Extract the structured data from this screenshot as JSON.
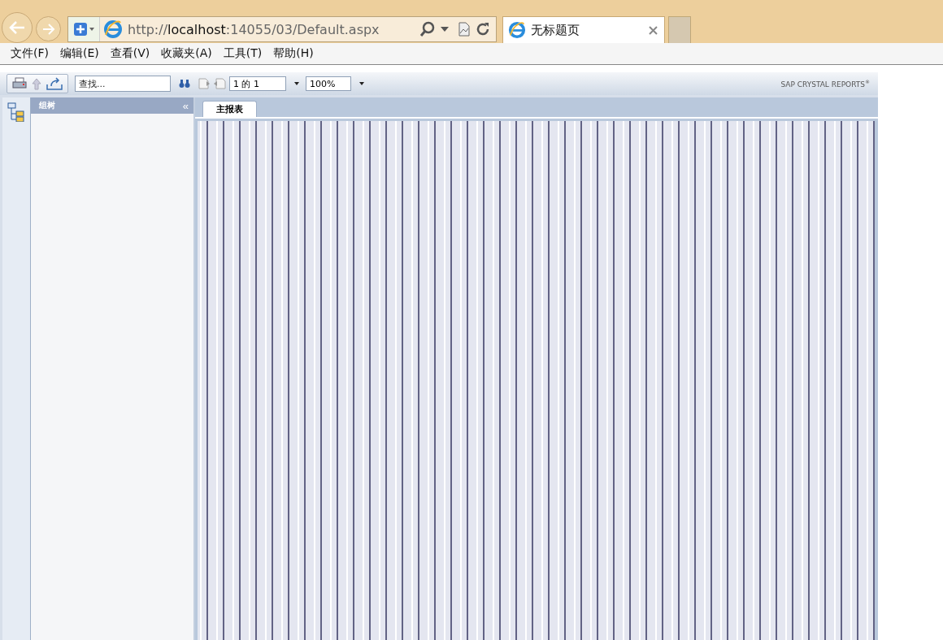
{
  "browser": {
    "url_prefix": "http://",
    "url_host": "localhost",
    "url_rest": ":14055/03/Default.aspx",
    "tab_title": "无标题页"
  },
  "menu": [
    "文件(F)",
    "编辑(E)",
    "查看(V)",
    "收藏夹(A)",
    "工具(T)",
    "帮助(H)"
  ],
  "viewer": {
    "search": {
      "placeholder": "查找..."
    },
    "page": "1 的 1",
    "zoom": "100%",
    "brand": "SAP CRYSTAL REPORTS",
    "brand_mark": "®",
    "panel_title": "组树",
    "collapse": "«",
    "report_tab": "主报表"
  }
}
